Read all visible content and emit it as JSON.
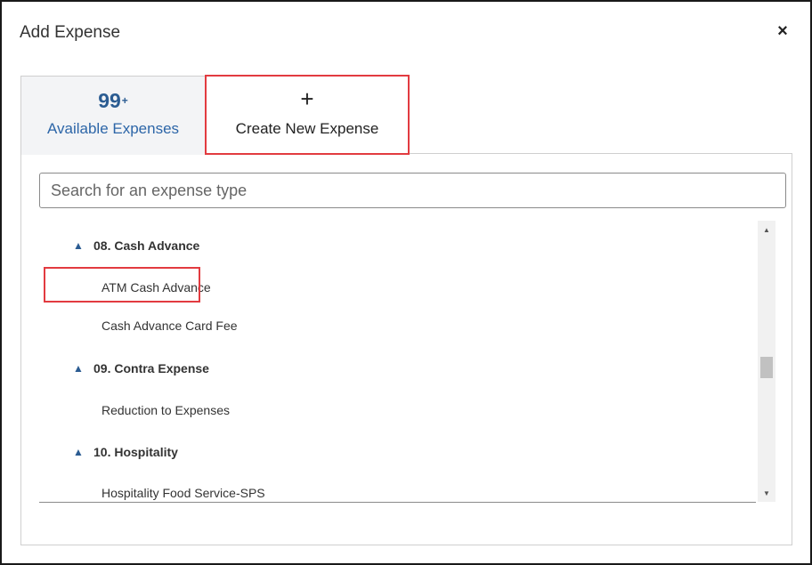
{
  "dialog": {
    "title": "Add Expense",
    "close_symbol": "×",
    "close_icon": "close-icon"
  },
  "tabs": {
    "available": {
      "count": "99",
      "count_suffix": "+",
      "label": "Available Expenses",
      "selected": false
    },
    "create": {
      "icon": "plus-icon",
      "symbol": "+",
      "label": "Create New Expense",
      "selected": true
    }
  },
  "search": {
    "placeholder": "Search for an expense type",
    "value": ""
  },
  "expense_groups": [
    {
      "label": "08. Cash Advance",
      "expanded": true,
      "items": [
        "ATM Cash Advance",
        "Cash Advance Card Fee"
      ]
    },
    {
      "label": "09. Contra Expense",
      "expanded": true,
      "items": [
        "Reduction to Expenses"
      ]
    },
    {
      "label": "10. Hospitality",
      "expanded": true,
      "items": [
        "Hospitality Food Service-SPS"
      ]
    }
  ],
  "scrollbar": {
    "up_symbol": "▲",
    "down_symbol": "▼"
  },
  "colors": {
    "accent_blue": "#2b5c92",
    "link_blue": "#2d66a8",
    "highlight_red": "#e23b40",
    "border_gray": "#cfcfcf",
    "tab_bg": "#f3f4f6"
  }
}
